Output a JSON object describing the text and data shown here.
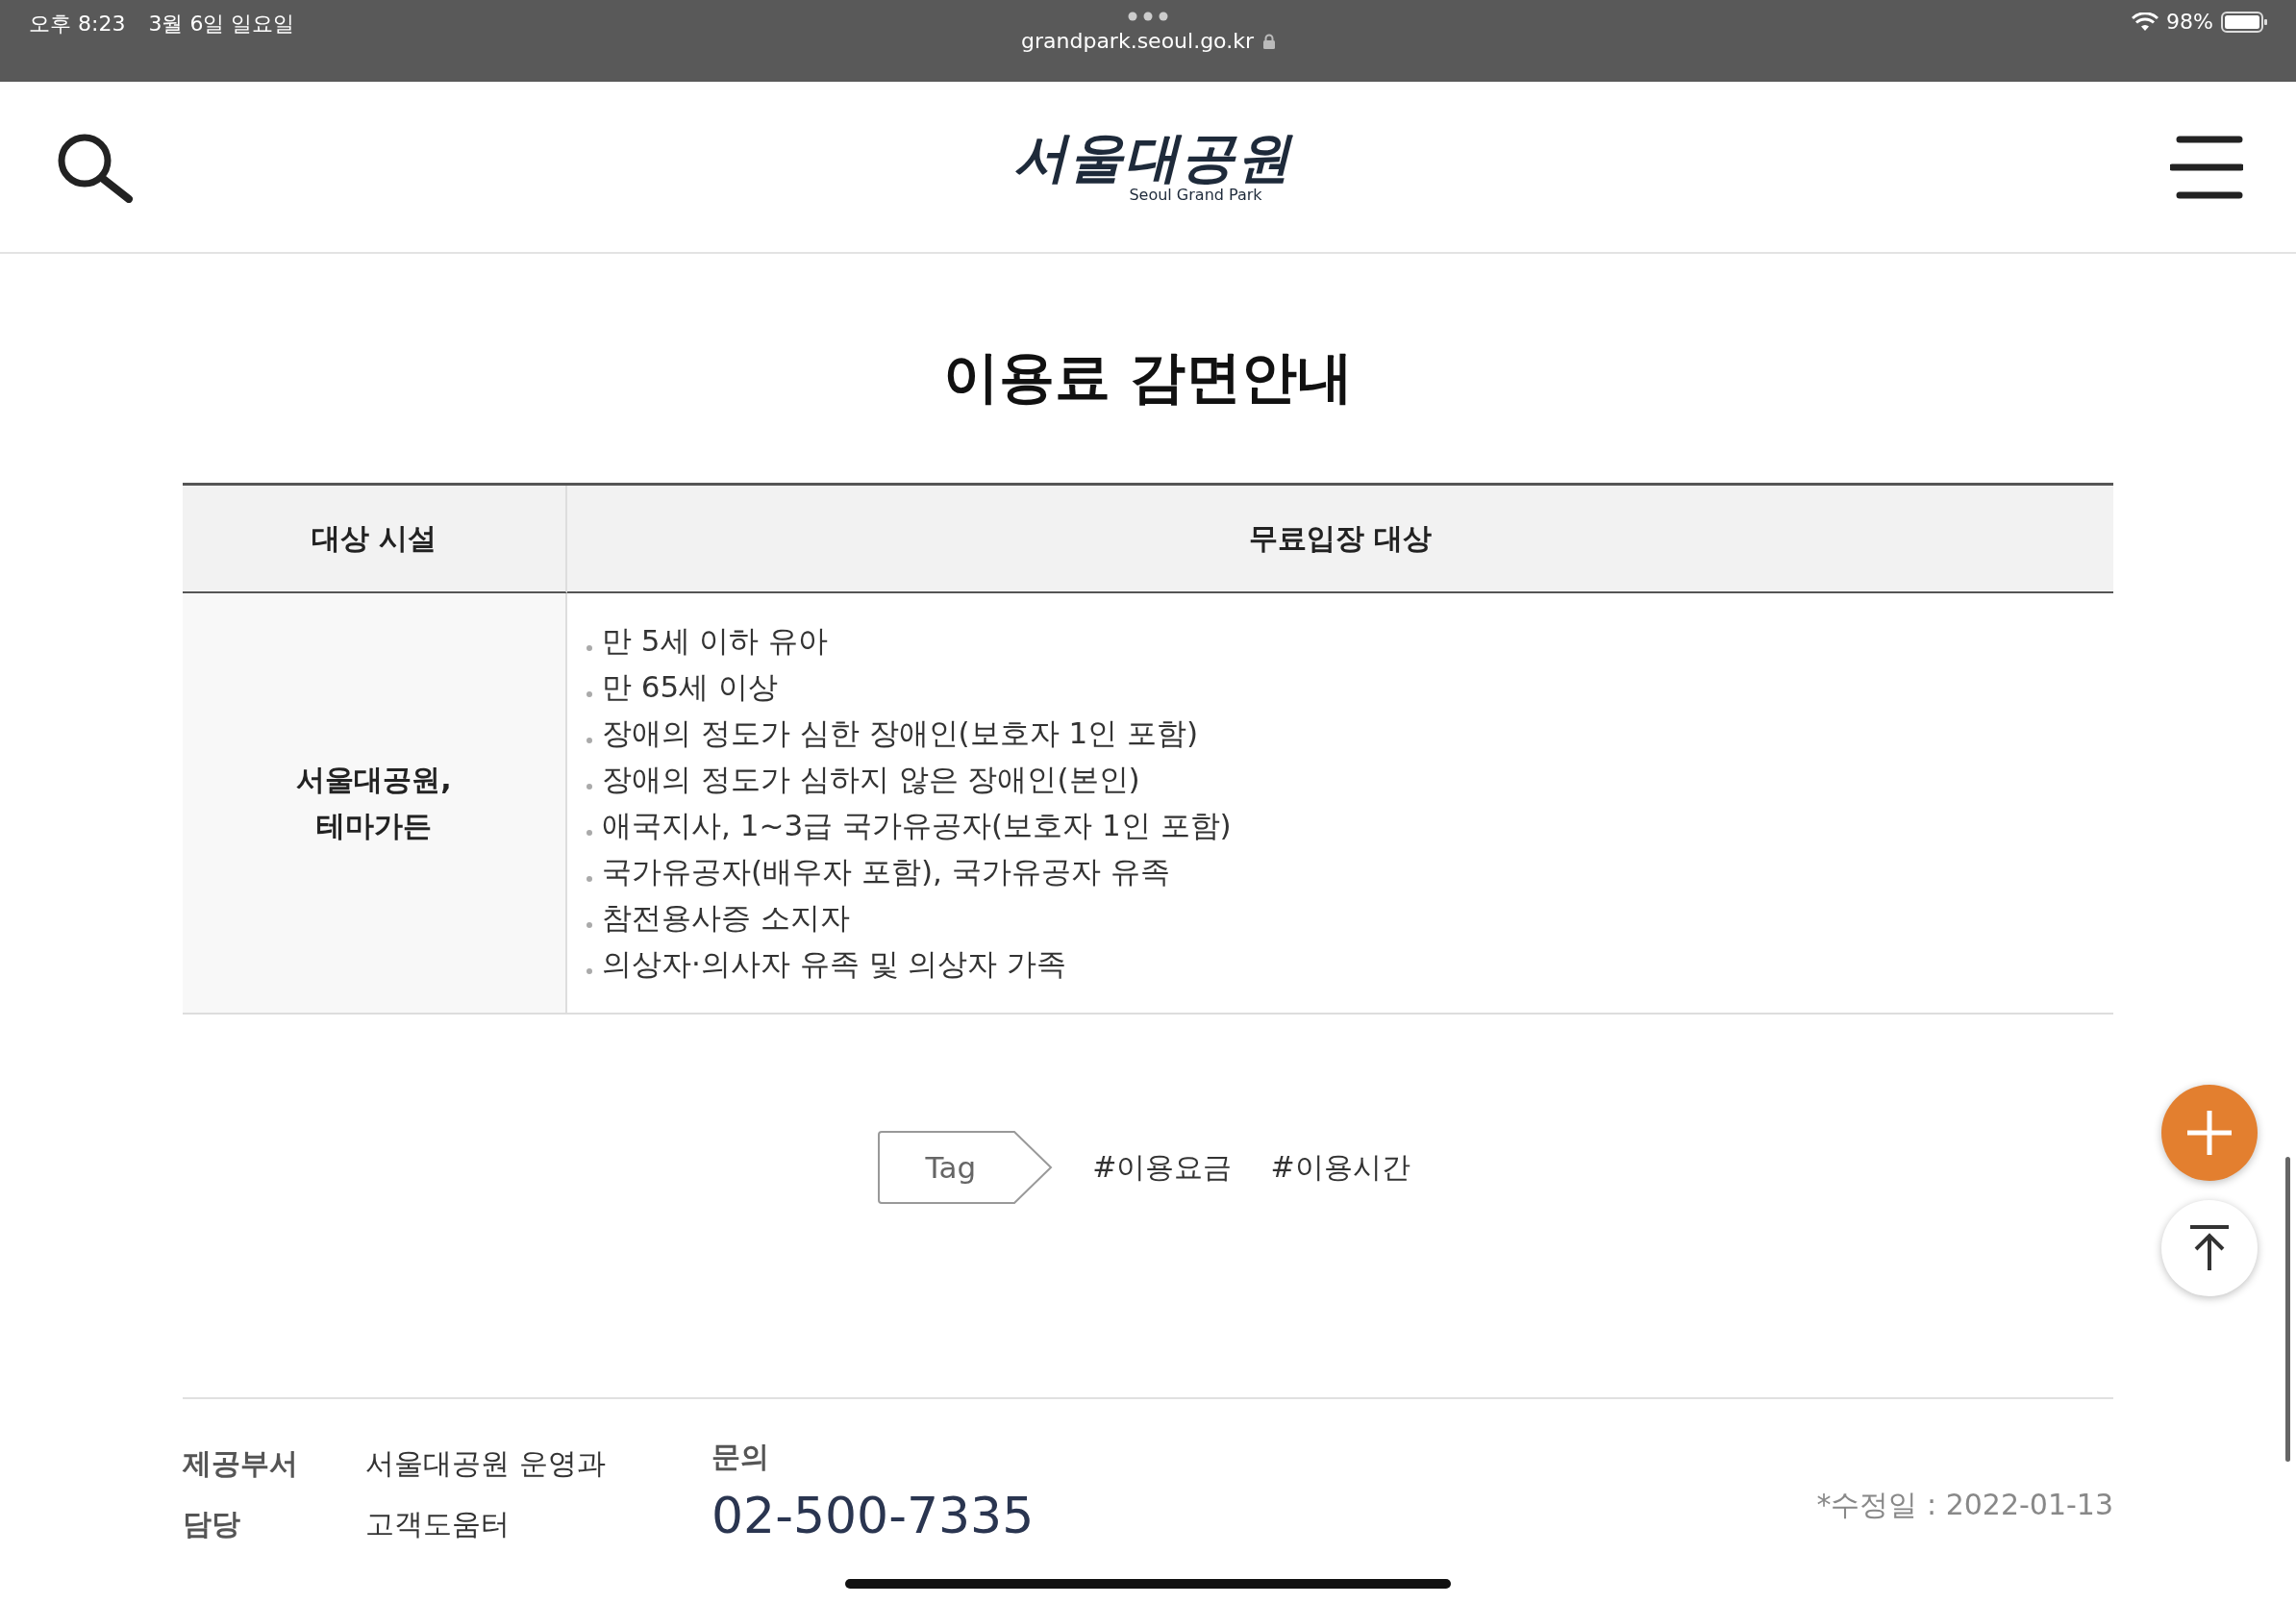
{
  "status_bar": {
    "time": "오후 8:23",
    "date": "3월 6일 일요일",
    "url": "grandpark.seoul.go.kr",
    "battery": "98%"
  },
  "header": {
    "logo": {
      "title": "서울대공원",
      "subtitle": "Seoul Grand Park"
    }
  },
  "page_title": "이용료 감면안내",
  "table": {
    "columns": [
      "대상 시설",
      "무료입장 대상"
    ],
    "rows": [
      {
        "facility": [
          "서울대공원,",
          "테마가든"
        ],
        "items": [
          "만 5세 이하 유아",
          "만 65세 이상",
          "장애의 정도가 심한 장애인(보호자 1인 포함)",
          "장애의 정도가 심하지 않은 장애인(본인)",
          "애국지사, 1~3급 국가유공자(보호자 1인 포함)",
          "국가유공자(배우자 포함), 국가유공자 유족",
          "참전용사증 소지자",
          "의상자·의사자 유족 및 의상자 가족"
        ]
      }
    ]
  },
  "tags": {
    "label": "Tag",
    "items": [
      "#이용요금",
      "#이용시간"
    ]
  },
  "footer": {
    "fields": [
      {
        "label": "제공부서",
        "value": "서울대공원 운영과"
      },
      {
        "label": "담당",
        "value": "고객도움터"
      }
    ],
    "contact": {
      "label": "문의",
      "phone": "02-500-7335"
    },
    "modified": "*수정일 : 2022-01-13"
  }
}
